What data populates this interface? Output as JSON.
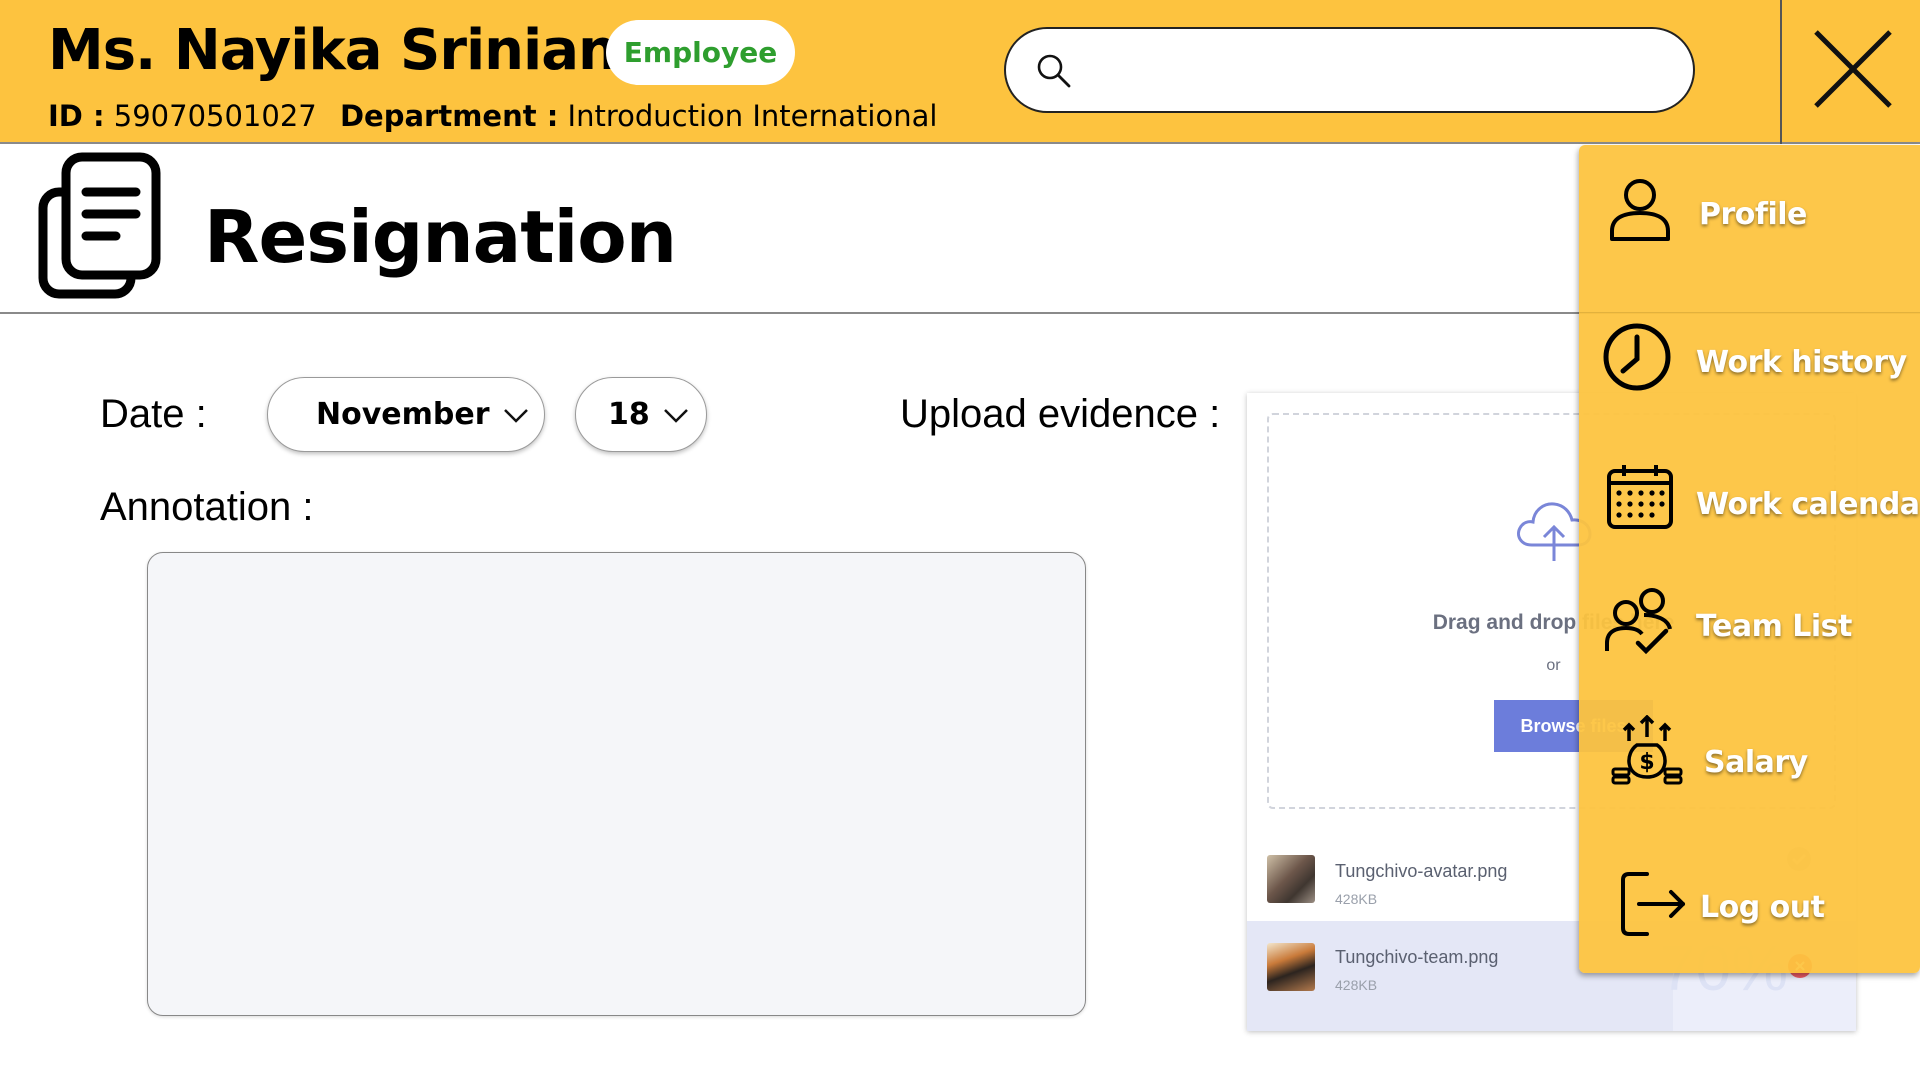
{
  "header": {
    "employee_name": "Ms. Nayika Srinian",
    "role_badge": "Employee",
    "id_label": "ID :",
    "id_value": "59070501027",
    "department_label": "Department :",
    "department_value": "Introduction International",
    "search": {
      "value": "",
      "icon": "search-icon"
    },
    "close_icon": "close-icon"
  },
  "page": {
    "title": "Resignation",
    "title_icon": "document-stack-icon"
  },
  "form": {
    "date_label": "Date :",
    "month_selected": "November",
    "day_selected": "18",
    "annotation_label": "Annotation :",
    "annotation_value": "",
    "upload_label": "Upload evidence :"
  },
  "upload": {
    "drop_text": "Drag and drop files here",
    "or_text": "or",
    "browse_label": "Browse files",
    "files": [
      {
        "name": "Tungchivo-avatar.png",
        "size": "428KB",
        "status": "complete"
      },
      {
        "name": "Tungchivo-team.png",
        "size": "428KB",
        "status": "uploading",
        "progress_text": "70%",
        "progress": 0.7
      }
    ]
  },
  "menu": {
    "items": [
      {
        "label": "Profile",
        "icon": "user-icon"
      },
      {
        "label": "Work history",
        "icon": "clock-icon"
      },
      {
        "label": "Work calendar",
        "icon": "calendar-icon"
      },
      {
        "label": "Team List",
        "icon": "team-check-icon"
      },
      {
        "label": "Salary",
        "icon": "money-bag-icon"
      },
      {
        "label": "Log out",
        "icon": "logout-icon"
      }
    ]
  },
  "colors": {
    "header_bg": "#fdc33f",
    "badge_text": "#2e9e2e",
    "browse_button": "#6c7ddb",
    "menu_text": "#ffffff"
  }
}
